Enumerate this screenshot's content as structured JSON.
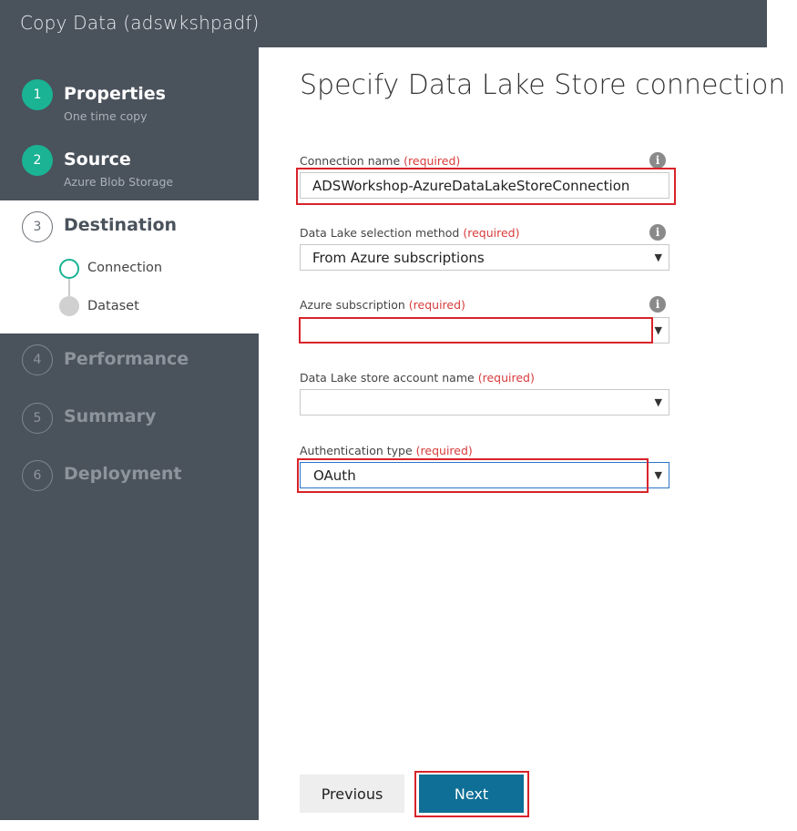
{
  "window": {
    "title": "Copy Data (adswkshpadf)"
  },
  "steps": [
    {
      "number": "1",
      "title": "Properties",
      "subtitle": "One time copy"
    },
    {
      "number": "2",
      "title": "Source",
      "subtitle": "Azure Blob Storage"
    },
    {
      "number": "3",
      "title": "Destination",
      "substeps": [
        "Connection",
        "Dataset"
      ]
    },
    {
      "number": "4",
      "title": "Performance"
    },
    {
      "number": "5",
      "title": "Summary"
    },
    {
      "number": "6",
      "title": "Deployment"
    }
  ],
  "form": {
    "title": "Specify Data Lake Store connection",
    "required_text": "(required)",
    "info_glyph": "i",
    "dropdown_arrow": "▼",
    "fields": {
      "connection_name": {
        "label": "Connection name",
        "value": "ADSWorkshop-AzureDataLakeStoreConnection"
      },
      "selection_method": {
        "label": "Data Lake selection method",
        "value": "From Azure subscriptions"
      },
      "subscription": {
        "label": "Azure subscription",
        "value": ""
      },
      "account_name": {
        "label": "Data Lake store account name",
        "value": ""
      },
      "auth_type": {
        "label": "Authentication type",
        "value": "OAuth"
      }
    }
  },
  "buttons": {
    "previous": "Previous",
    "next": "Next"
  },
  "colors": {
    "sidebar": "#4a525c",
    "done": "#1ab394",
    "primary": "#0f6f96",
    "highlight": "#d8232a",
    "required": "#d83b3b"
  }
}
